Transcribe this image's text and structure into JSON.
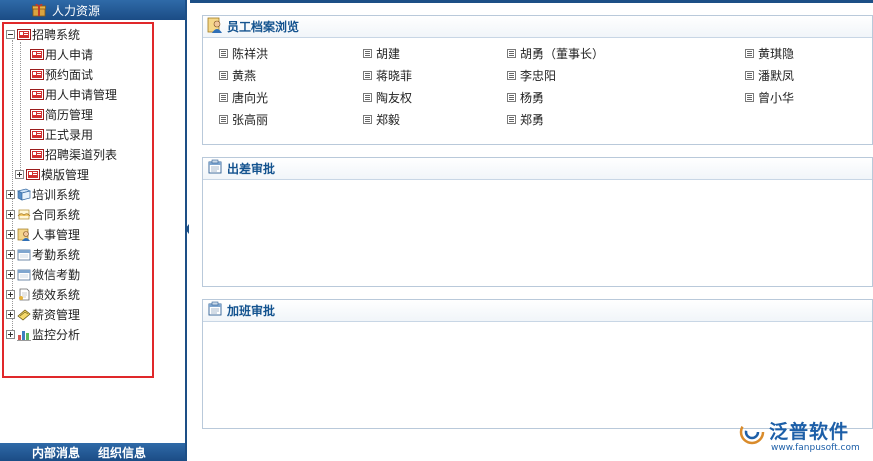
{
  "left_panel": {
    "header_title": "人力资源",
    "tree": [
      {
        "label": "招聘系统",
        "expanded": true,
        "icon": "folder-card-icon"
      },
      {
        "label": "用人申请",
        "icon": "card-icon"
      },
      {
        "label": "预约面试",
        "icon": "card-icon"
      },
      {
        "label": "用人申请管理",
        "icon": "card-icon"
      },
      {
        "label": "简历管理",
        "icon": "card-icon"
      },
      {
        "label": "正式录用",
        "icon": "card-icon"
      },
      {
        "label": "招聘渠道列表",
        "icon": "card-icon"
      },
      {
        "label": "模版管理",
        "icon": "card-icon"
      },
      {
        "label": "培训系统",
        "icon": "notebook-icon"
      },
      {
        "label": "合同系统",
        "icon": "handshake-icon"
      },
      {
        "label": "人事管理",
        "icon": "person-icon"
      },
      {
        "label": "考勤系统",
        "icon": "calendar-icon"
      },
      {
        "label": "微信考勤",
        "icon": "calendar-icon"
      },
      {
        "label": "绩效系统",
        "icon": "document-icon"
      },
      {
        "label": "薪资管理",
        "icon": "money-icon"
      },
      {
        "label": "监控分析",
        "icon": "bar-chart-icon"
      }
    ],
    "footer_tabs": [
      "内部消息",
      "组织信息"
    ]
  },
  "main": {
    "employee_panel": {
      "title": "员工档案浏览",
      "employees": [
        [
          "陈祥洪",
          "胡建",
          "胡勇（董事长）",
          "黄琪隐"
        ],
        [
          "黄燕",
          "蒋晓菲",
          "李忠阳",
          "潘默凤"
        ],
        [
          "唐向光",
          "陶友权",
          "杨勇",
          "曾小华"
        ],
        [
          "张高丽",
          "郑毅",
          "郑勇",
          ""
        ]
      ]
    },
    "trip_panel": {
      "title": "出差审批"
    },
    "overtime_panel": {
      "title": "加班审批"
    }
  },
  "brand": {
    "name": "泛普软件",
    "url": "www.fanpusoft.com",
    "color": "#1d5fa8"
  },
  "colors": {
    "header_blue": "#1d4f86",
    "highlight_red": "#e0282a",
    "panel_title": "#14538f"
  }
}
